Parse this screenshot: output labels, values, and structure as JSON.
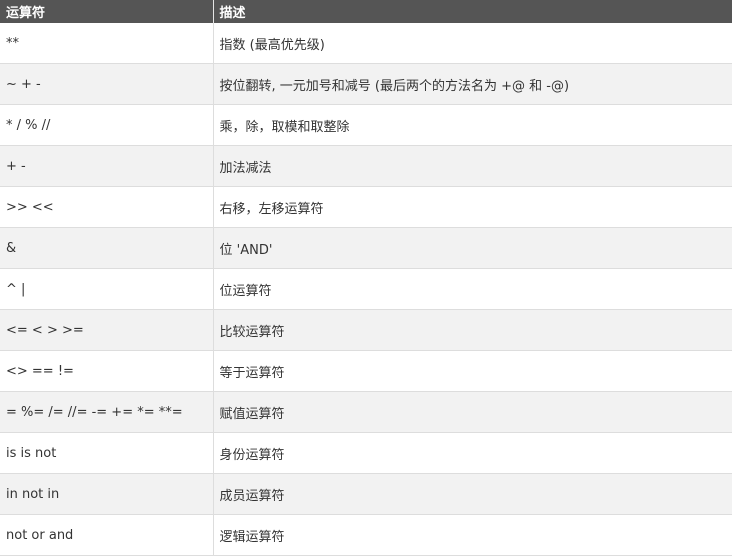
{
  "table": {
    "headers": [
      "运算符",
      "描述"
    ],
    "rows": [
      {
        "operator": "**",
        "description": "指数 (最高优先级)"
      },
      {
        "operator": "~ + -",
        "description": "按位翻转, 一元加号和减号 (最后两个的方法名为 +@ 和 -@)"
      },
      {
        "operator": "* / % //",
        "description": "乘，除，取模和取整除"
      },
      {
        "operator": "+ -",
        "description": "加法减法"
      },
      {
        "operator": ">> <<",
        "description": "右移，左移运算符"
      },
      {
        "operator": "&",
        "description": "位 'AND'"
      },
      {
        "operator": "^ |",
        "description": "位运算符"
      },
      {
        "operator": "<= < > >=",
        "description": "比较运算符"
      },
      {
        "operator": "<> == !=",
        "description": "等于运算符"
      },
      {
        "operator": "= %= /= //= -= += *= **=",
        "description": "赋值运算符"
      },
      {
        "operator": "is is not",
        "description": "身份运算符"
      },
      {
        "operator": "in not in",
        "description": "成员运算符"
      },
      {
        "operator": "not or and",
        "description": "逻辑运算符"
      }
    ]
  },
  "colors": {
    "header_background": "#555555",
    "header_text": "#ffffff",
    "row_alt_background": "#f2f2f2",
    "border": "#dddddd"
  }
}
